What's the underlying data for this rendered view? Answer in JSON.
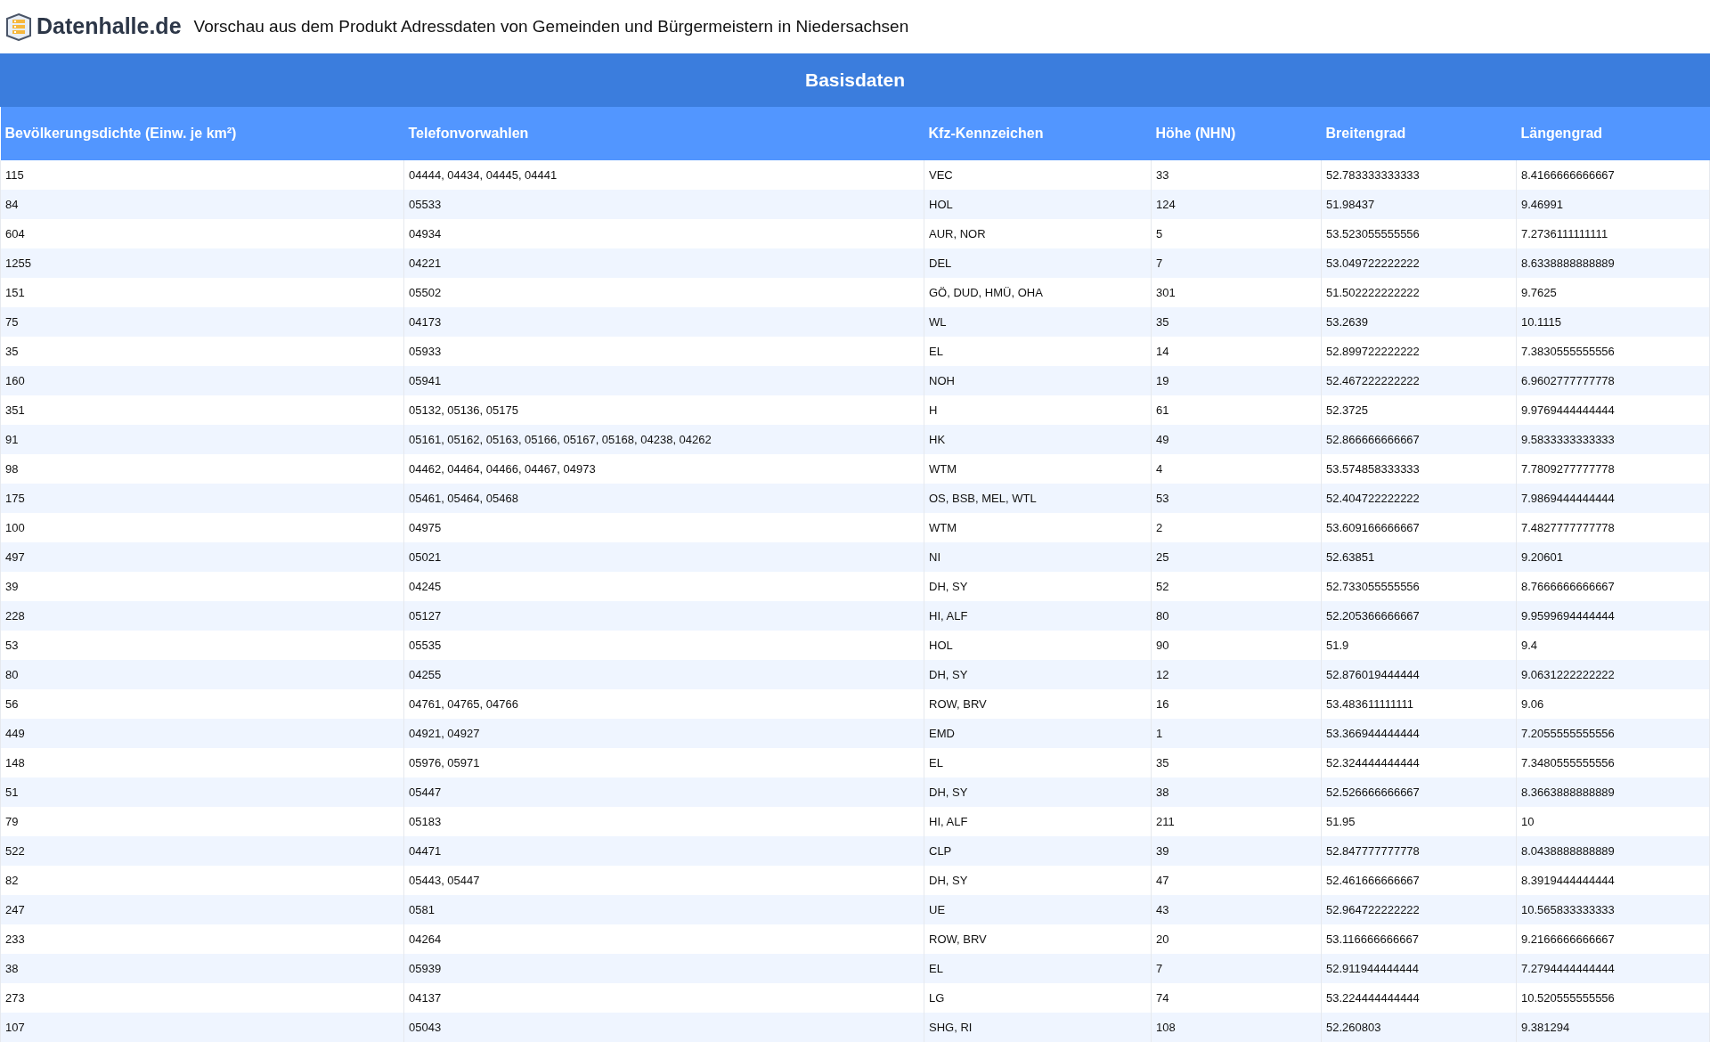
{
  "header": {
    "logo_text": "Datenhalle.de",
    "title": "Vorschau aus dem Produkt Adressdaten von Gemeinden und Bürgermeistern in Niedersachsen"
  },
  "table": {
    "caption": "Basisdaten",
    "columns": [
      "Bevölkerungsdichte (Einw. je km²)",
      "Telefonvorwahlen",
      "Kfz-Kennzeichen",
      "Höhe (NHN)",
      "Breitengrad",
      "Längengrad"
    ],
    "rows": [
      [
        "115",
        "04444, 04434, 04445, 04441",
        "VEC",
        "33",
        "52.783333333333",
        "8.4166666666667"
      ],
      [
        "84",
        "05533",
        "HOL",
        "124",
        "51.98437",
        "9.46991"
      ],
      [
        "604",
        "04934",
        "AUR, NOR",
        "5",
        "53.523055555556",
        "7.2736111111111"
      ],
      [
        "1255",
        "04221",
        "DEL",
        "7",
        "53.049722222222",
        "8.6338888888889"
      ],
      [
        "151",
        "05502",
        "GÖ, DUD, HMÜ, OHA",
        "301",
        "51.502222222222",
        "9.7625"
      ],
      [
        "75",
        "04173",
        "WL",
        "35",
        "53.2639",
        "10.1115"
      ],
      [
        "35",
        "05933",
        "EL",
        "14",
        "52.899722222222",
        "7.3830555555556"
      ],
      [
        "160",
        "05941",
        "NOH",
        "19",
        "52.467222222222",
        "6.9602777777778"
      ],
      [
        "351",
        "05132, 05136, 05175",
        "H",
        "61",
        "52.3725",
        "9.9769444444444"
      ],
      [
        "91",
        "05161, 05162, 05163, 05166, 05167, 05168, 04238, 04262",
        "HK",
        "49",
        "52.866666666667",
        "9.5833333333333"
      ],
      [
        "98",
        "04462, 04464, 04466, 04467, 04973",
        "WTM",
        "4",
        "53.574858333333",
        "7.7809277777778"
      ],
      [
        "175",
        "05461, 05464, 05468",
        "OS, BSB, MEL, WTL",
        "53",
        "52.404722222222",
        "7.9869444444444"
      ],
      [
        "100",
        "04975",
        "WTM",
        "2",
        "53.609166666667",
        "7.4827777777778"
      ],
      [
        "497",
        "05021",
        "NI",
        "25",
        "52.63851",
        "9.20601"
      ],
      [
        "39",
        "04245",
        "DH, SY",
        "52",
        "52.733055555556",
        "8.7666666666667"
      ],
      [
        "228",
        "05127",
        "HI, ALF",
        "80",
        "52.205366666667",
        "9.9599694444444"
      ],
      [
        "53",
        "05535",
        "HOL",
        "90",
        "51.9",
        "9.4"
      ],
      [
        "80",
        "04255",
        "DH, SY",
        "12",
        "52.876019444444",
        "9.0631222222222"
      ],
      [
        "56",
        "04761, 04765, 04766",
        "ROW, BRV",
        "16",
        "53.483611111111",
        "9.06"
      ],
      [
        "449",
        "04921, 04927",
        "EMD",
        "1",
        "53.366944444444",
        "7.2055555555556"
      ],
      [
        "148",
        "05976, 05971",
        "EL",
        "35",
        "52.324444444444",
        "7.3480555555556"
      ],
      [
        "51",
        "05447",
        "DH, SY",
        "38",
        "52.526666666667",
        "8.3663888888889"
      ],
      [
        "79",
        "05183",
        "HI, ALF",
        "211",
        "51.95",
        "10"
      ],
      [
        "522",
        "04471",
        "CLP",
        "39",
        "52.847777777778",
        "8.0438888888889"
      ],
      [
        "82",
        "05443, 05447",
        "DH, SY",
        "47",
        "52.461666666667",
        "8.3919444444444"
      ],
      [
        "247",
        "0581",
        "UE",
        "43",
        "52.964722222222",
        "10.565833333333"
      ],
      [
        "233",
        "04264",
        "ROW, BRV",
        "20",
        "53.116666666667",
        "9.2166666666667"
      ],
      [
        "38",
        "05939",
        "EL",
        "7",
        "52.911944444444",
        "7.2794444444444"
      ],
      [
        "273",
        "04137",
        "LG",
        "74",
        "53.224444444444",
        "10.520555555556"
      ],
      [
        "107",
        "05043",
        "SHG, RI",
        "108",
        "52.260803",
        "9.381294"
      ]
    ]
  }
}
